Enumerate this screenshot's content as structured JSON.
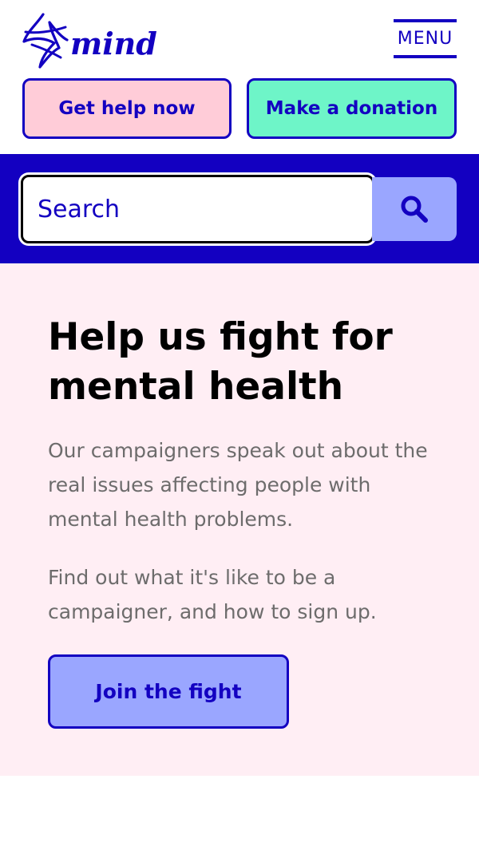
{
  "header": {
    "logo_text": "mind",
    "menu_label": "MENU"
  },
  "actions": {
    "help_label": "Get help now",
    "donate_label": "Make a donation"
  },
  "search": {
    "placeholder": "Search",
    "button_icon": "search-icon"
  },
  "hero": {
    "title": "Help us fight for mental health",
    "paragraph1": "Our campaigners speak out about the real issues affecting people with mental health problems.",
    "paragraph2": "Find out what it's like to be a campaigner, and how to sign up.",
    "cta_label": "Join the fight"
  },
  "colors": {
    "brand_blue": "#1300c1",
    "help_pink": "#ffccd8",
    "donate_green": "#6ef5c8",
    "periwinkle": "#9aa6ff",
    "hero_bg": "#ffeef4"
  }
}
